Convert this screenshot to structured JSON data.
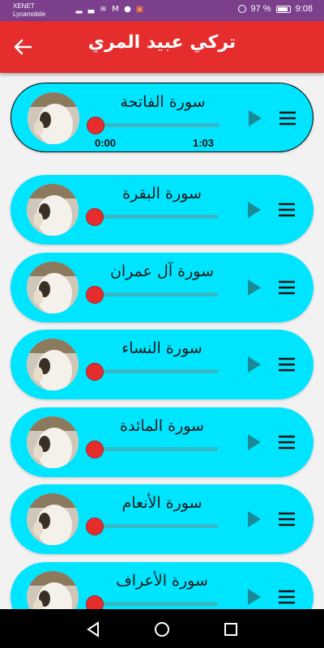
{
  "status_bar": {
    "carrier_line1": "XENET",
    "carrier_line2": "Lycamobile",
    "battery_percent": "97 %",
    "time": "9:08"
  },
  "app_bar": {
    "title": "تركي عبيد المري",
    "back_icon": "arrow-left-icon"
  },
  "surahs": [
    {
      "name": "سورة الفاتحة",
      "active": true,
      "current_time": "0:00",
      "total_time": "1:03",
      "progress": 0
    },
    {
      "name": "سورة البقرة",
      "active": false,
      "progress": 0
    },
    {
      "name": "سورة آل عمران",
      "active": false,
      "progress": 0
    },
    {
      "name": "سورة النساء",
      "active": false,
      "progress": 0
    },
    {
      "name": "سورة المائدة",
      "active": false,
      "progress": 0
    },
    {
      "name": "سورة الأنعام",
      "active": false,
      "progress": 0
    },
    {
      "name": "سورة الأعراف",
      "active": false,
      "progress": 0
    }
  ],
  "icons": {
    "play": "play-icon",
    "menu": "menu-icon"
  },
  "colors": {
    "app_bar": "#e52d2d",
    "card": "#00e5ff",
    "track": "#35b9c6",
    "thumb": "#e52d2d",
    "play": "#1a8a96",
    "status_bar": "#7b3f8c"
  }
}
